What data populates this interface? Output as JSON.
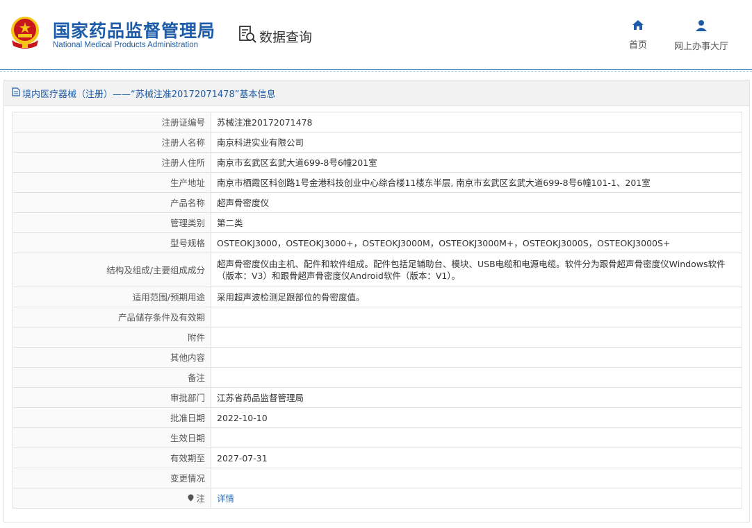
{
  "header": {
    "org_cn": "国家药品监督管理局",
    "org_en": "National Medical Products Administration",
    "query_label": "数据查询",
    "nav": {
      "home": "首页",
      "hall": "网上办事大厅"
    }
  },
  "panel": {
    "title": "境内医疗器械（注册）——“苏械注准20172071478”基本信息"
  },
  "rows": [
    {
      "key": "注册证编号",
      "value": "苏械注准20172071478"
    },
    {
      "key": "注册人名称",
      "value": "南京科进实业有限公司"
    },
    {
      "key": "注册人住所",
      "value": "南京市玄武区玄武大道699-8号6幢201室"
    },
    {
      "key": "生产地址",
      "value": "南京市栖霞区科创路1号金港科技创业中心综合楼11楼东半层, 南京市玄武区玄武大道699-8号6幢101-1、201室"
    },
    {
      "key": "产品名称",
      "value": "超声骨密度仪"
    },
    {
      "key": "管理类别",
      "value": "第二类"
    },
    {
      "key": "型号规格",
      "value": "OSTEOKJ3000，OSTEOKJ3000+，OSTEOKJ3000M，OSTEOKJ3000M+，OSTEOKJ3000S，OSTEOKJ3000S+"
    },
    {
      "key": "结构及组成/主要组成成分",
      "value": "超声骨密度仪由主机、配件和软件组成。配件包括足辅助台、模块、USB电缆和电源电缆。软件分为跟骨超声骨密度仪Windows软件（版本：V3）和跟骨超声骨密度仪Android软件（版本：V1）。"
    },
    {
      "key": "适用范围/预期用途",
      "value": "采用超声波检测足跟部位的骨密度值。"
    },
    {
      "key": "产品储存条件及有效期",
      "value": ""
    },
    {
      "key": "附件",
      "value": ""
    },
    {
      "key": "其他内容",
      "value": ""
    },
    {
      "key": "备注",
      "value": ""
    },
    {
      "key": "审批部门",
      "value": "江苏省药品监督管理局"
    },
    {
      "key": "批准日期",
      "value": "2022-10-10"
    },
    {
      "key": "生效日期",
      "value": ""
    },
    {
      "key": "有效期至",
      "value": "2027-07-31"
    },
    {
      "key": "变更情况",
      "value": ""
    }
  ],
  "note": {
    "key": "注",
    "link": "详情"
  },
  "colors": {
    "brand": "#1d5ca8",
    "link": "#2f6fb4",
    "emblem_red": "#c8161d",
    "emblem_gold": "#f5c518"
  },
  "icons": [
    "emblem-icon",
    "search-doc-icon",
    "home-icon",
    "user-icon",
    "document-icon",
    "pin-icon"
  ]
}
